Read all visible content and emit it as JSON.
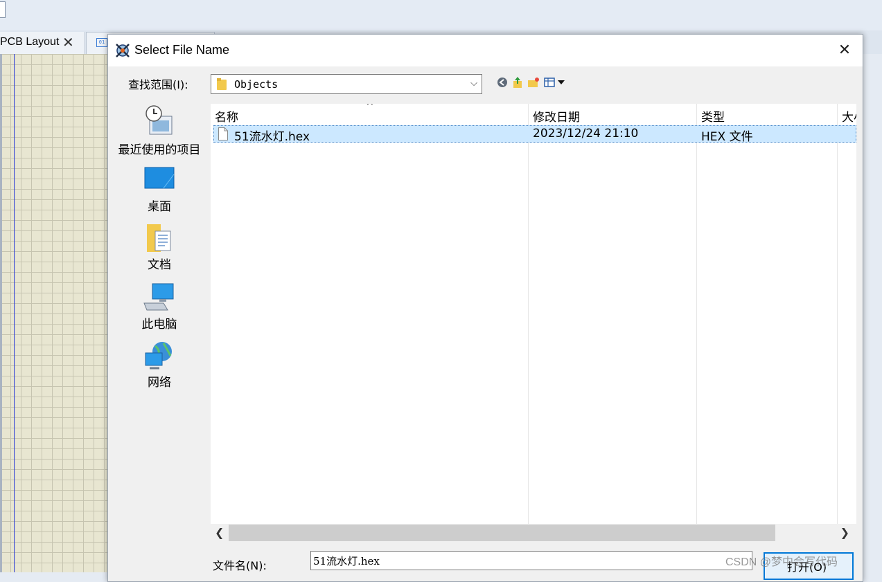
{
  "app": {
    "tabs": [
      {
        "label": "PCB Layout",
        "close": "✕"
      },
      {
        "label": "",
        "icon": "binary-file-icon"
      }
    ]
  },
  "dialog": {
    "title": "Select File Name",
    "close_glyph": "✕",
    "look_in": {
      "label": "查找范围(I):",
      "value": "Objects",
      "arrow": "⌵"
    },
    "nav": [
      "back-icon",
      "up-folder-icon",
      "new-folder-icon",
      "view-menu-icon"
    ],
    "places": [
      {
        "label": "最近使用的项目",
        "icon": "recent-items-icon"
      },
      {
        "label": "桌面",
        "icon": "desktop-icon"
      },
      {
        "label": "文档",
        "icon": "documents-icon"
      },
      {
        "label": "此电脑",
        "icon": "this-pc-icon"
      },
      {
        "label": "网络",
        "icon": "network-icon"
      }
    ],
    "columns": [
      "名称",
      "修改日期",
      "类型",
      "大小"
    ],
    "sort_glyph": "^",
    "files": [
      {
        "name": "51流水灯.hex",
        "modified": "2023/12/24 21:10",
        "type": "HEX 文件"
      }
    ],
    "scroll": {
      "left": "❮",
      "right": "❯"
    },
    "filename": {
      "label": "文件名(N):",
      "value": "51流水灯.hex"
    },
    "open_button": "打开(O)"
  },
  "watermark": "CSDN @梦中会写代码"
}
